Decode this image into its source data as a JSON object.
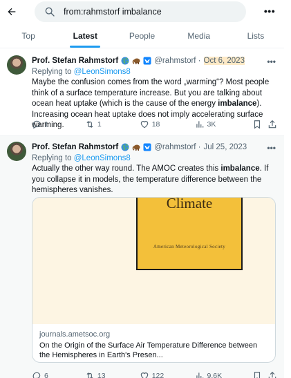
{
  "search": {
    "query": "from:rahmstorf imbalance"
  },
  "tabs": [
    {
      "label": "Top"
    },
    {
      "label": "Latest"
    },
    {
      "label": "People"
    },
    {
      "label": "Media"
    },
    {
      "label": "Lists"
    }
  ],
  "active_tab": "Latest",
  "tweets": [
    {
      "name": "Prof. Stefan Rahmstorf",
      "handle": "@rahmstorf ·",
      "date": "Oct 6, 2023",
      "replying_prefix": "Replying to ",
      "replying_to": "@LeonSimons8",
      "text_parts": [
        "Maybe the confusion comes from the word „warming“? Most people think of a surface temperature increase. But you are talking about ocean heat uptake (which is the cause of the energy ",
        "imbalance",
        ").  Increasing ocean heat uptake does not imply accelerating surface warming."
      ],
      "stats": {
        "replies": "1",
        "retweets": "1",
        "likes": "18",
        "views": "3K"
      }
    },
    {
      "name": "Prof. Stefan Rahmstorf",
      "handle": "@rahmstorf ·",
      "date": "Jul 25, 2023",
      "replying_prefix": "Replying to ",
      "replying_to": "@LeonSimons8",
      "text_parts": [
        "Actually the other way round. The AMOC creates this ",
        "imbalance",
        ". If you collapse it in models, the temperature difference between the hemispheres vanishes."
      ],
      "card": {
        "cover_title": "Climate",
        "cover_sub": "American Meteorological Society",
        "domain": "journals.ametsoc.org",
        "title": "On the Origin of the Surface Air Temperature Difference between the Hemispheres in Earth's Presen..."
      },
      "stats": {
        "replies": "6",
        "retweets": "13",
        "likes": "122",
        "views": "9.6K"
      }
    }
  ],
  "colors": {
    "accent": "#1d9bf0",
    "date_highlight": "#fde9c6",
    "cover": "#f3c03a"
  }
}
